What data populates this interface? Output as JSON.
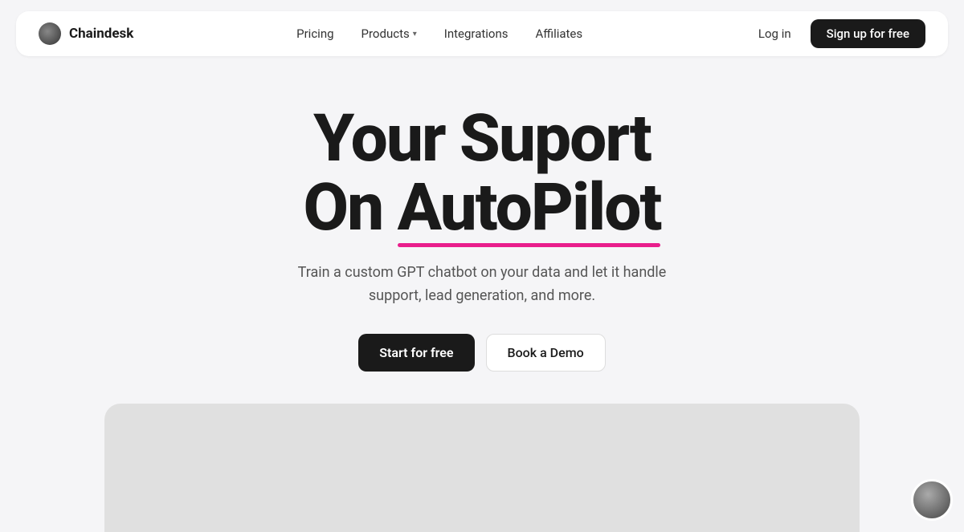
{
  "navbar": {
    "logo_text": "Chaindesk",
    "nav_items": [
      {
        "label": "Pricing",
        "has_chevron": false
      },
      {
        "label": "Products",
        "has_chevron": true
      },
      {
        "label": "Integrations",
        "has_chevron": false
      },
      {
        "label": "Affiliates",
        "has_chevron": false
      }
    ],
    "login_label": "Log in",
    "signup_label": "Sign up for free"
  },
  "hero": {
    "title_line1": "Your Suport",
    "title_line2": "On AutoPilot",
    "subtitle": "Train a custom GPT chatbot on your data and let it handle support, lead generation, and more.",
    "btn_primary": "Start for free",
    "btn_secondary": "Book a Demo"
  },
  "colors": {
    "accent_pink": "#e91e8c",
    "dark": "#1a1a1a",
    "light_bg": "#f5f5f7"
  }
}
